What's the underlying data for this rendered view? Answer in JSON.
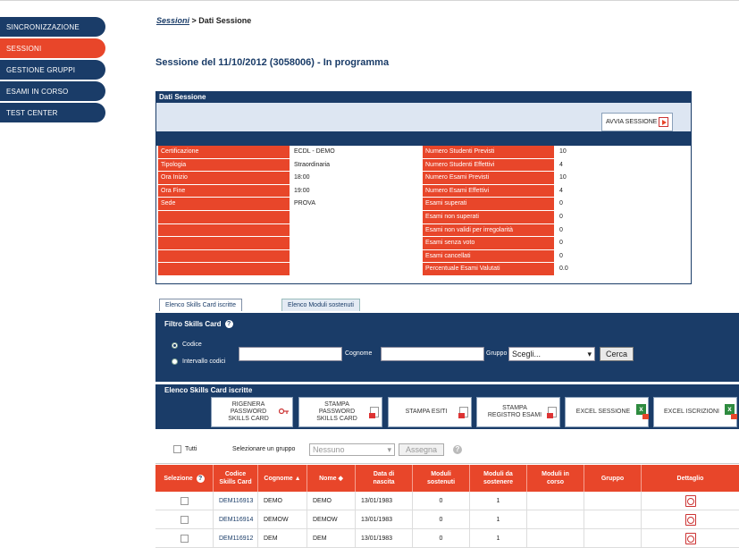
{
  "sidebar": {
    "items": [
      {
        "label": "SINCRONIZZAZIONE",
        "active": false
      },
      {
        "label": "SESSIONI",
        "active": true
      },
      {
        "label": "GESTIONE GRUPPI",
        "active": false
      },
      {
        "label": "ESAMI IN CORSO",
        "active": false
      },
      {
        "label": "TEST CENTER",
        "active": false
      }
    ]
  },
  "breadcrumb": {
    "link": "Sessioni",
    "separator": " > ",
    "current": "Dati Sessione"
  },
  "page_title": "Sessione del 11/10/2012 (3058006) - In programma",
  "dati_sessione": {
    "title": "Dati Sessione",
    "avvia_label": "AVVIA SESSIONE",
    "left": [
      {
        "label": "Certificazione",
        "value": "ECDL - DEMO"
      },
      {
        "label": "Tipologia",
        "value": "Straordinaria"
      },
      {
        "label": "Ora Inizio",
        "value": "18:00"
      },
      {
        "label": "Ora Fine",
        "value": "19:00"
      },
      {
        "label": "Sede",
        "value": "PROVA"
      },
      {
        "label": "",
        "value": ""
      },
      {
        "label": "",
        "value": ""
      },
      {
        "label": "",
        "value": ""
      },
      {
        "label": "",
        "value": ""
      },
      {
        "label": "",
        "value": ""
      }
    ],
    "right": [
      {
        "label": "Numero Studenti Previsti",
        "value": "10"
      },
      {
        "label": "Numero Studenti Effettivi",
        "value": "4"
      },
      {
        "label": "Numero Esami Previsti",
        "value": "10"
      },
      {
        "label": "Numero Esami Effettivi",
        "value": "4"
      },
      {
        "label": "Esami superati",
        "value": "0"
      },
      {
        "label": "Esami non superati",
        "value": "0"
      },
      {
        "label": "Esami non validi per irregolarità",
        "value": "0"
      },
      {
        "label": "Esami senza voto",
        "value": "0"
      },
      {
        "label": "Esami cancellati",
        "value": "0"
      },
      {
        "label": "Percentuale Esami Valutati",
        "value": "0.0"
      }
    ]
  },
  "tabs": [
    {
      "label": "Elenco Skills Card iscritte",
      "active": true
    },
    {
      "label": "Elenco Moduli sostenuti",
      "active": false
    }
  ],
  "filtro": {
    "title": "Filtro Skills Card",
    "radio_codice": "Codice",
    "radio_intervallo": "Intervallo codici",
    "cognome_label": "Cognome",
    "gruppo_label": "Gruppo",
    "gruppo_selected": "Scegli...",
    "cerca_label": "Cerca"
  },
  "elenco": {
    "title": "Elenco Skills Card iscritte",
    "buttons": {
      "rigenera": "RIGENERA PASSWORD SKILLS CARD",
      "stampa_password": "STAMPA PASSWORD SKILLS CARD",
      "stampa_esiti": "STAMPA ESITI",
      "stampa_registro": "STAMPA REGISTRO ESAMI",
      "excel_sessione": "EXCEL SESSIONE",
      "excel_iscrizioni": "EXCEL ISCRIZIONI"
    }
  },
  "selezione": {
    "tutti_label": "Tutti",
    "gruppo_label": "Selezionare un gruppo",
    "gruppo_selected": "Nessuno",
    "assegna_label": "Assegna"
  },
  "table": {
    "headers": {
      "selezione": "Selezione",
      "codice": "Codice Skills Card",
      "cognome": "Cognome",
      "nome": "Nome",
      "nascita": "Data di nascita",
      "sostenuti": "Moduli sostenuti",
      "da_sostenere": "Moduli da sostenere",
      "in_corso": "Moduli in corso",
      "gruppo": "Gruppo",
      "dettaglio": "Dettaglio"
    },
    "rows": [
      {
        "codice": "DEM116913",
        "cognome": "DEMO",
        "nome": "DEMO",
        "nascita": "13/01/1983",
        "sostenuti": "0",
        "da_sostenere": "1",
        "in_corso": "",
        "gruppo": ""
      },
      {
        "codice": "DEM116914",
        "cognome": "DEMOW",
        "nome": "DEMOW",
        "nascita": "13/01/1983",
        "sostenuti": "0",
        "da_sostenere": "1",
        "in_corso": "",
        "gruppo": ""
      },
      {
        "codice": "DEM116912",
        "cognome": "DEM",
        "nome": "DEM",
        "nascita": "13/01/1983",
        "sostenuti": "0",
        "da_sostenere": "1",
        "in_corso": "",
        "gruppo": ""
      }
    ]
  }
}
